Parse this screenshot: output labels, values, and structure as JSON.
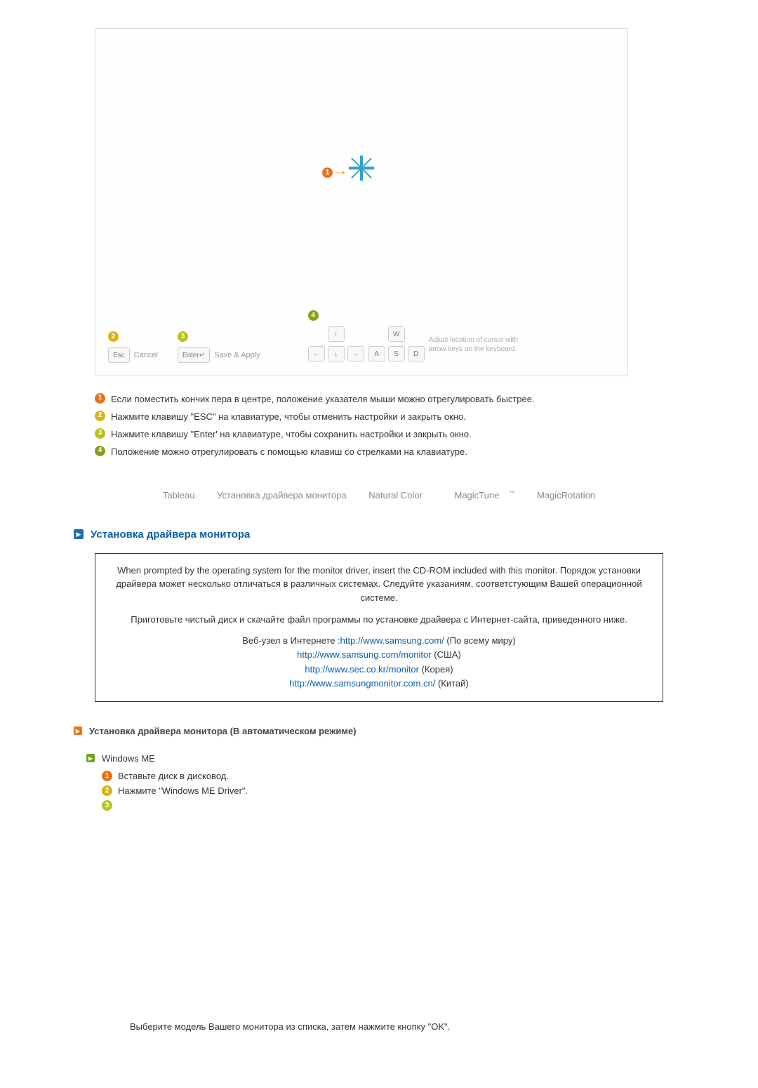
{
  "calib": {
    "esc_key": "Esc",
    "cancel_label": "Cancel",
    "enter_key": "Enter↵",
    "save_apply_label": "Save & Apply",
    "w": "W",
    "a": "A",
    "s": "S",
    "d": "D",
    "arrow_hint": "Adjust location of cursor with arrow keys on the keyboard."
  },
  "callouts": {
    "c1": "Если поместить кончик пера в центре, положение указателя мыши можно отрегулировать быстрее.",
    "c2": "Нажмите клавишу \"ESC\" на клавиатуре, чтобы отменить настройки и закрыть окно.",
    "c3": "Нажмите клавишу \"Enter' на клавиатуре, чтобы сохранить настройки и закрыть окно.",
    "c4": "Положение можно отрегулировать с помощью клавиш со стрелками на клавиатуре."
  },
  "nav": {
    "t1": "Tableau",
    "t2": "Установка драйвера монитора",
    "t3": "Natural Color",
    "t4": "MagicTune",
    "t4_tm": "™",
    "t5": "MagicRotation"
  },
  "section": {
    "title": "Установка драйвера монитора"
  },
  "driverbox": {
    "p1": "When prompted by the operating system for the monitor driver, insert the CD-ROM included with this monitor. Порядок установки драйвера может несколько отличаться в различных системах. Следуйте указаниям, соответстующим Вашей операционной системе.",
    "p2": "Приготовьте чистый диск и скачайте файл программы по установке драйвера с Интернет-сайта, приведенного ниже.",
    "web_label": "Веб-узел в Интернете :",
    "l1_url": "http://www.samsung.com/",
    "l1_suffix": " (По всему миру)",
    "l2_url": "http://www.samsung.com/monitor",
    "l2_suffix": " (США)",
    "l3_url": "http://www.sec.co.kr/monitor",
    "l3_suffix": " (Корея)",
    "l4_url": "http://www.samsungmonitor.com.cn/",
    "l4_suffix": " (Китай)"
  },
  "sub": {
    "auto_title": "Установка драйвера монитора (В автоматическом режиме)",
    "os": "Windows ME",
    "step1": "Вставьте диск в дисковод.",
    "step2": "Нажмите \"Windows ME Driver\"."
  },
  "bottom_note": "Выберите модель Вашего монитора из списка, затем нажмите кнопку \"OK\"."
}
